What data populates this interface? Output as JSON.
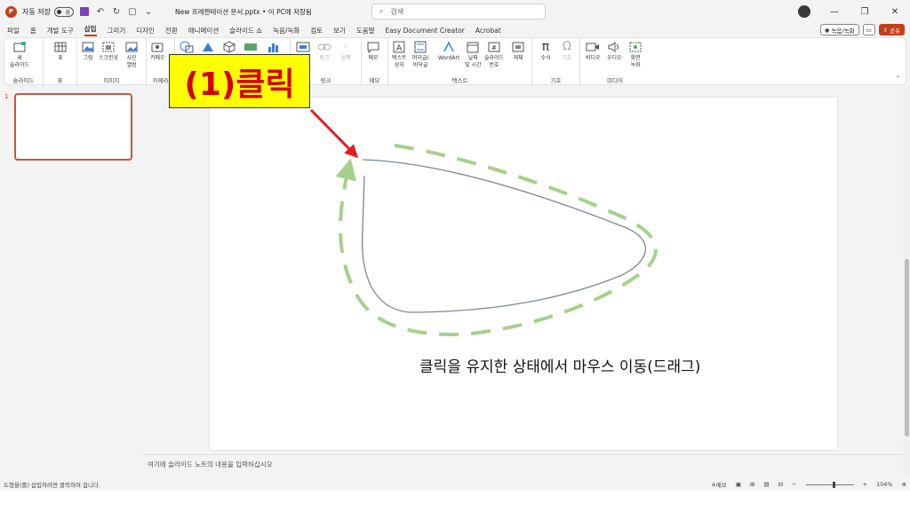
{
  "titlebar": {
    "autosave_label": "자동 저장",
    "autosave_state": "끔",
    "document_title": "New 프레젠테이션 문서.pptx • 이 PC에 저장됨",
    "search_placeholder": "검색"
  },
  "tabs": [
    "파일",
    "홈",
    "개발 도구",
    "삽입",
    "그리기",
    "디자인",
    "전환",
    "애니메이션",
    "슬라이드 쇼",
    "녹음/녹화",
    "검토",
    "보기",
    "도움말",
    "Easy Document Creator",
    "Acrobat"
  ],
  "active_tab": "삽입",
  "tab_actions": {
    "record_label": "녹음/녹화",
    "share_label": "공유"
  },
  "ribbon": {
    "groups": {
      "slides": "슬라이드",
      "table": "표",
      "images": "이미지",
      "camera": "카메라",
      "links": "링크",
      "comments": "메모",
      "text": "텍스트",
      "symbols": "기호",
      "media": "미디어"
    },
    "commands": {
      "new_slide": "새\n슬라이드",
      "table": "표",
      "picture": "그림",
      "screenshot": "스크린샷",
      "photo_album": "사진\n앨범",
      "cameo": "카메오",
      "link": "링크",
      "action": "실행",
      "comment": "메모",
      "textbox": "텍스트\n상자",
      "header_footer": "머리글/\n바닥글",
      "wordart": "WordArt",
      "date_time": "날짜\n및 시간",
      "slide_number": "슬라이드\n번호",
      "object": "개체",
      "equation": "수식",
      "symbol": "기호",
      "video": "비디오",
      "audio": "오디오",
      "screen_recording": "화면\n녹화"
    }
  },
  "thumbnail_number": "1",
  "callout_text": "(1)클릭",
  "slide_caption": "클릭을 유지한 상태에서 마우스 이동(드래그)",
  "notes_placeholder": "여기에 슬라이드 노트의 내용을 입력하십시오",
  "status": {
    "hint": "도형을(를) 삽입하려면 클릭하여 끕니다.",
    "notes_label": "메모",
    "zoom": "104%"
  },
  "colors": {
    "brand": "#c43e1c",
    "arrow_green": "#a8d08d",
    "callout_bg": "#ffff00",
    "callout_text": "#d40000",
    "pointer_red": "#e02020",
    "stroke": "#7d8893"
  }
}
